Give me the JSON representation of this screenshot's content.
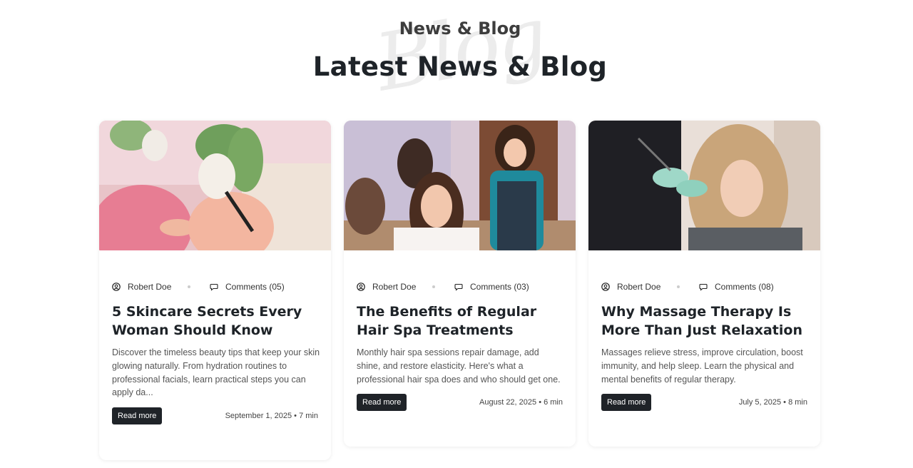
{
  "header": {
    "eyebrow": "News & Blog",
    "title": "Latest News & Blog",
    "watermark": "Blog"
  },
  "colors": {
    "heading": "#1e2328",
    "button_bg": "#1f2328",
    "button_text": "#ffffff"
  },
  "posts": [
    {
      "author": "Robert Doe",
      "comments": "Comments (05)",
      "title": "5 Skincare Secrets Every Woman Should Know",
      "excerpt": "Discover the timeless beauty tips that keep your skin glowing naturally. From hydration routines to professional facials, learn practical steps you can apply da...",
      "button": "Read more",
      "date": "September 1, 2025 • 7 min",
      "image": "women-facial-mask-photo"
    },
    {
      "author": "Robert Doe",
      "comments": "Comments (03)",
      "title": "The Benefits of Regular Hair Spa Treatments",
      "excerpt": "Monthly hair spa sessions repair damage, add shine, and restore elasticity. Here's what a professional hair spa does and who should get one.",
      "button": "Read more",
      "date": "August 22, 2025 • 6 min",
      "image": "hair-salon-photo"
    },
    {
      "author": "Robert Doe",
      "comments": "Comments (08)",
      "title": "Why Massage Therapy Is More Than Just Relaxation",
      "excerpt": "Massages relieve stress, improve circulation, boost immunity, and help sleep. Learn the physical and mental benefits of regular therapy.",
      "button": "Read more",
      "date": "July 5, 2025 • 8 min",
      "image": "hair-coloring-photo"
    }
  ]
}
